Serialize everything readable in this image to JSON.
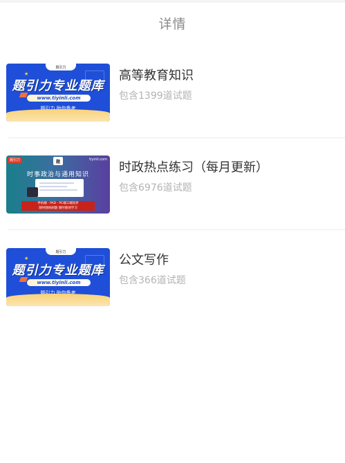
{
  "header": {
    "title": "详情"
  },
  "items": [
    {
      "title": "高等教育知识",
      "subtitle": "包含1399道试题",
      "thumb": {
        "headline": "题引力专业题库",
        "url": "www.tiyinli.com",
        "tagline": "题引力 助你备考",
        "logo_text": "题引力"
      }
    },
    {
      "title": "时政热点练习（每月更新）",
      "subtitle": "包含6976道试题",
      "thumb": {
        "badge": "题引力",
        "site": "tiyinli.com",
        "headline": "时事政治与通用知识",
        "logo_text": "题",
        "line1": "手机端 · PAD · PC端三端同步",
        "line2": "随时随地刷题 随时随地学习"
      }
    },
    {
      "title": "公文写作",
      "subtitle": "包含366道试题",
      "thumb": {
        "headline": "题引力专业题库",
        "url": "www.tiyinli.com",
        "tagline": "题引力 助你备考",
        "logo_text": "题引力"
      }
    }
  ],
  "colors": {
    "promo_blue": "#1f4fd8",
    "promo_yellow": "#f9d27a",
    "title": "#333333",
    "subtitle": "#b3b3b3",
    "header": "#8a8a8a"
  }
}
